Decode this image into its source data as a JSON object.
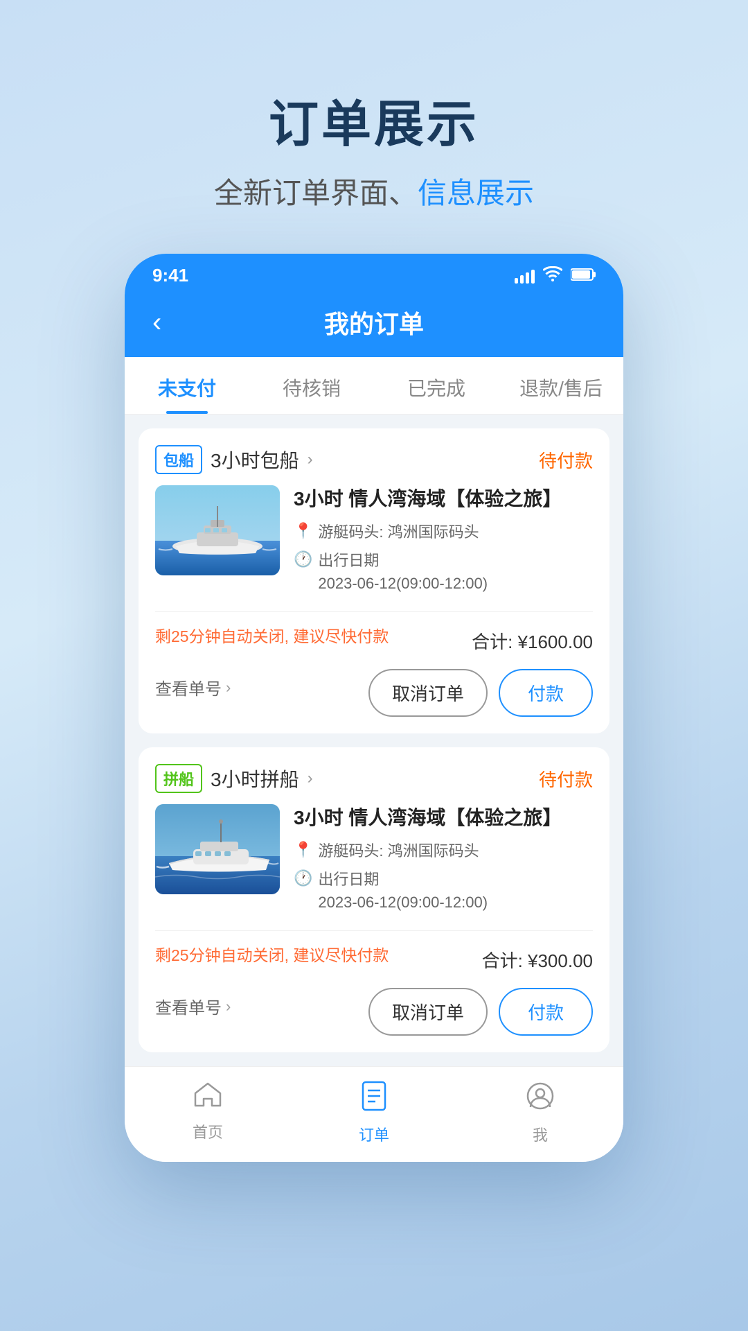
{
  "page": {
    "title": "订单展示",
    "subtitle_plain": "全新订单界面、",
    "subtitle_highlight": "信息展示"
  },
  "statusBar": {
    "time": "9:41",
    "wifiIcon": "wifi-icon",
    "batteryIcon": "battery-icon"
  },
  "navBar": {
    "backIcon": "‹",
    "title": "我的订单"
  },
  "tabs": [
    {
      "id": "unpaid",
      "label": "未支付",
      "active": true
    },
    {
      "id": "pending",
      "label": "待核销",
      "active": false
    },
    {
      "id": "completed",
      "label": "已完成",
      "active": false
    },
    {
      "id": "refund",
      "label": "退款/售后",
      "active": false
    }
  ],
  "orders": [
    {
      "tag": "包船",
      "tagClass": "tag-baochuan",
      "typeText": "3小时包船",
      "status": "待付款",
      "name": "3小时 情人湾海域【体验之旅】",
      "location": "游艇码头: 鸿洲国际码头",
      "dateLabel": "出行日期",
      "date": "2023-06-12(09:00-12:00)",
      "alertText": "剩25分钟自动关闭, 建议尽快付款",
      "total": "合计: ¥1600.00",
      "viewLink": "查看单号",
      "cancelLabel": "取消订单",
      "payLabel": "付款"
    },
    {
      "tag": "拼船",
      "tagClass": "tag-pinchuan",
      "typeText": "3小时拼船",
      "status": "待付款",
      "name": "3小时 情人湾海域【体验之旅】",
      "location": "游艇码头: 鸿洲国际码头",
      "dateLabel": "出行日期",
      "date": "2023-06-12(09:00-12:00)",
      "alertText": "剩25分钟自动关闭, 建议尽快付款",
      "total": "合计: ¥300.00",
      "viewLink": "查看单号",
      "cancelLabel": "取消订单",
      "payLabel": "付款"
    }
  ],
  "bottomNav": [
    {
      "id": "home",
      "icon": "⌂",
      "label": "首页",
      "active": false
    },
    {
      "id": "orders",
      "icon": "📋",
      "label": "订单",
      "active": true
    },
    {
      "id": "profile",
      "icon": "☺",
      "label": "我",
      "active": false
    }
  ]
}
